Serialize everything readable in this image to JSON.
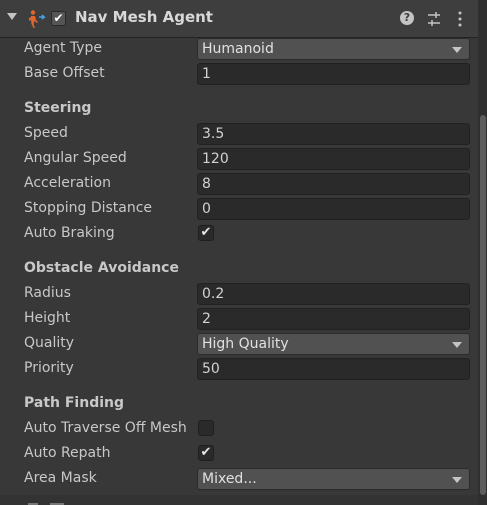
{
  "component": {
    "title": "Nav Mesh Agent",
    "enabled_check": "✔",
    "icons": {
      "foldout": "foldout-arrow-icon",
      "agent": "nav-mesh-agent-icon",
      "help": "help-icon",
      "settings": "preset-settings-icon",
      "menu": "kebab-menu-icon"
    },
    "help_glyph": "?"
  },
  "fields": {
    "agent_type": {
      "label": "Agent Type",
      "value": "Humanoid"
    },
    "base_offset": {
      "label": "Base Offset",
      "value": "1"
    }
  },
  "steering": {
    "heading": "Steering",
    "speed": {
      "label": "Speed",
      "value": "3.5"
    },
    "angular_speed": {
      "label": "Angular Speed",
      "value": "120"
    },
    "acceleration": {
      "label": "Acceleration",
      "value": "8"
    },
    "stopping_distance": {
      "label": "Stopping Distance",
      "value": "0"
    },
    "auto_braking": {
      "label": "Auto Braking",
      "checked": true,
      "mark": "✔"
    }
  },
  "obstacle_avoidance": {
    "heading": "Obstacle Avoidance",
    "radius": {
      "label": "Radius",
      "value": "0.2"
    },
    "height": {
      "label": "Height",
      "value": "2"
    },
    "quality": {
      "label": "Quality",
      "value": "High Quality"
    },
    "priority": {
      "label": "Priority",
      "value": "50"
    }
  },
  "path_finding": {
    "heading": "Path Finding",
    "auto_traverse": {
      "label": "Auto Traverse Off Mesh",
      "checked": false,
      "mark": ""
    },
    "auto_repath": {
      "label": "Auto Repath",
      "checked": true,
      "mark": "✔"
    },
    "area_mask": {
      "label": "Area Mask",
      "value": "Mixed..."
    }
  },
  "colors": {
    "background": "#383838",
    "header": "#3e3e3e",
    "field": "#2a2a2a",
    "dropdown": "#515151",
    "text": "#c8c8c8"
  }
}
